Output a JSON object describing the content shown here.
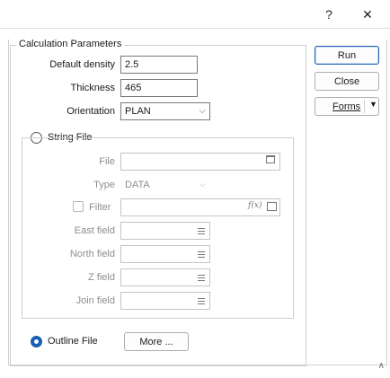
{
  "titlebar": {
    "help_icon": "?",
    "close_icon": "✕"
  },
  "calc": {
    "group_title": "Calculation Parameters",
    "default_density_label": "Default density",
    "default_density_value": "2.5",
    "thickness_label": "Thickness",
    "thickness_value": "465",
    "orientation_label": "Orientation",
    "orientation_value": "PLAN"
  },
  "string_file": {
    "radio_label": "String File",
    "file_label": "File",
    "type_label": "Type",
    "type_value": "DATA",
    "filter_label": "Filter",
    "east_label": "East field",
    "north_label": "North field",
    "z_label": "Z field",
    "join_label": "Join field"
  },
  "outline": {
    "radio_label": "Outline File",
    "more_label": "More ..."
  },
  "buttons": {
    "run": "Run",
    "close": "Close",
    "forms": "Forms"
  },
  "icons": {
    "filter_fx": "f(x)"
  }
}
